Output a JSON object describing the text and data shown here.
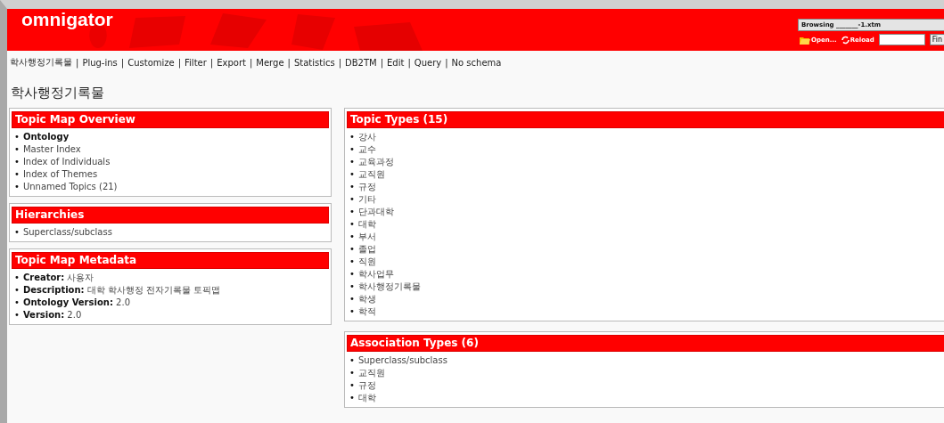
{
  "header": {
    "logo": "omnigator",
    "browsing": "Browsing _______-1.xtm",
    "open_button": "Open...",
    "reload_button": "Reload",
    "find_button": "Fin"
  },
  "nav": [
    {
      "label": "학사행정기록물"
    },
    {
      "separator": "|",
      "label": "Plug-ins"
    },
    {
      "separator": "|",
      "label": "Customize"
    },
    {
      "separator": "|",
      "label": "Filter"
    },
    {
      "separator": "|",
      "label": "Export"
    },
    {
      "separator": "|",
      "label": "Merge"
    },
    {
      "separator": "|",
      "label": "Statistics"
    },
    {
      "separator": "|",
      "label": "DB2TM"
    },
    {
      "separator": "|",
      "label": "Edit"
    },
    {
      "separator": "|",
      "label": "Query"
    },
    {
      "separator": "|",
      "label": "No schema"
    }
  ],
  "page_title": "학사행정기록물",
  "left_panels": [
    {
      "title": "Topic Map Overview",
      "items": [
        {
          "bullet": "•",
          "text": "Ontology",
          "selected": true
        },
        {
          "bullet": "•",
          "text": "Master Index",
          "selected": false
        },
        {
          "bullet": "•",
          "text": "Index of Individuals",
          "selected": false
        },
        {
          "bullet": "•",
          "text": "Index of Themes",
          "selected": false
        },
        {
          "bullet": "•",
          "text": "Unnamed Topics (21)",
          "selected": false
        }
      ]
    },
    {
      "title": "Hierarchies",
      "items": [
        {
          "bullet": "•",
          "text": "Superclass/subclass",
          "selected": false
        }
      ]
    },
    {
      "title": "Topic Map Metadata",
      "items": [
        {
          "bullet": "•",
          "text": "**Creator:** 사용자",
          "selected": false
        },
        {
          "bullet": "•",
          "text": "**Description:** 대학 학사행정 전자기록물 토픽맵",
          "selected": false
        },
        {
          "bullet": "•",
          "text": "**Ontology Version:** 2.0",
          "selected": false
        },
        {
          "bullet": "•",
          "text": "**Version:** 2.0",
          "selected": false
        }
      ]
    }
  ],
  "right_panels": [
    {
      "title": "Topic Types (15)",
      "items": [
        {
          "bullet": "•",
          "text": "강사",
          "selected": false
        },
        {
          "bullet": "•",
          "text": "교수",
          "selected": false
        },
        {
          "bullet": "•",
          "text": "교육과정",
          "selected": false
        },
        {
          "bullet": "•",
          "text": "교직원",
          "selected": false
        },
        {
          "bullet": "•",
          "text": "규정",
          "selected": false
        },
        {
          "bullet": "•",
          "text": "기타",
          "selected": false
        },
        {
          "bullet": "•",
          "text": "단과대학",
          "selected": false
        },
        {
          "bullet": "•",
          "text": "대학",
          "selected": false
        },
        {
          "bullet": "•",
          "text": "부서",
          "selected": false
        },
        {
          "bullet": "•",
          "text": "졸업",
          "selected": false
        },
        {
          "bullet": "•",
          "text": "직원",
          "selected": false
        },
        {
          "bullet": "•",
          "text": "학사업무",
          "selected": false
        },
        {
          "bullet": "•",
          "text": "학사행정기록물",
          "selected": false
        },
        {
          "bullet": "•",
          "text": "학생",
          "selected": false
        },
        {
          "bullet": "•",
          "text": "학적",
          "selected": false
        }
      ]
    },
    {
      "title": "Association Types (6)",
      "items": [
        {
          "bullet": "•",
          "text": "Superclass/subclass",
          "selected": false
        },
        {
          "bullet": "•",
          "text": "교직원",
          "selected": false
        },
        {
          "bullet": "•",
          "text": "규정",
          "selected": false
        },
        {
          "bullet": "•",
          "text": "대학",
          "selected": false
        }
      ]
    }
  ]
}
